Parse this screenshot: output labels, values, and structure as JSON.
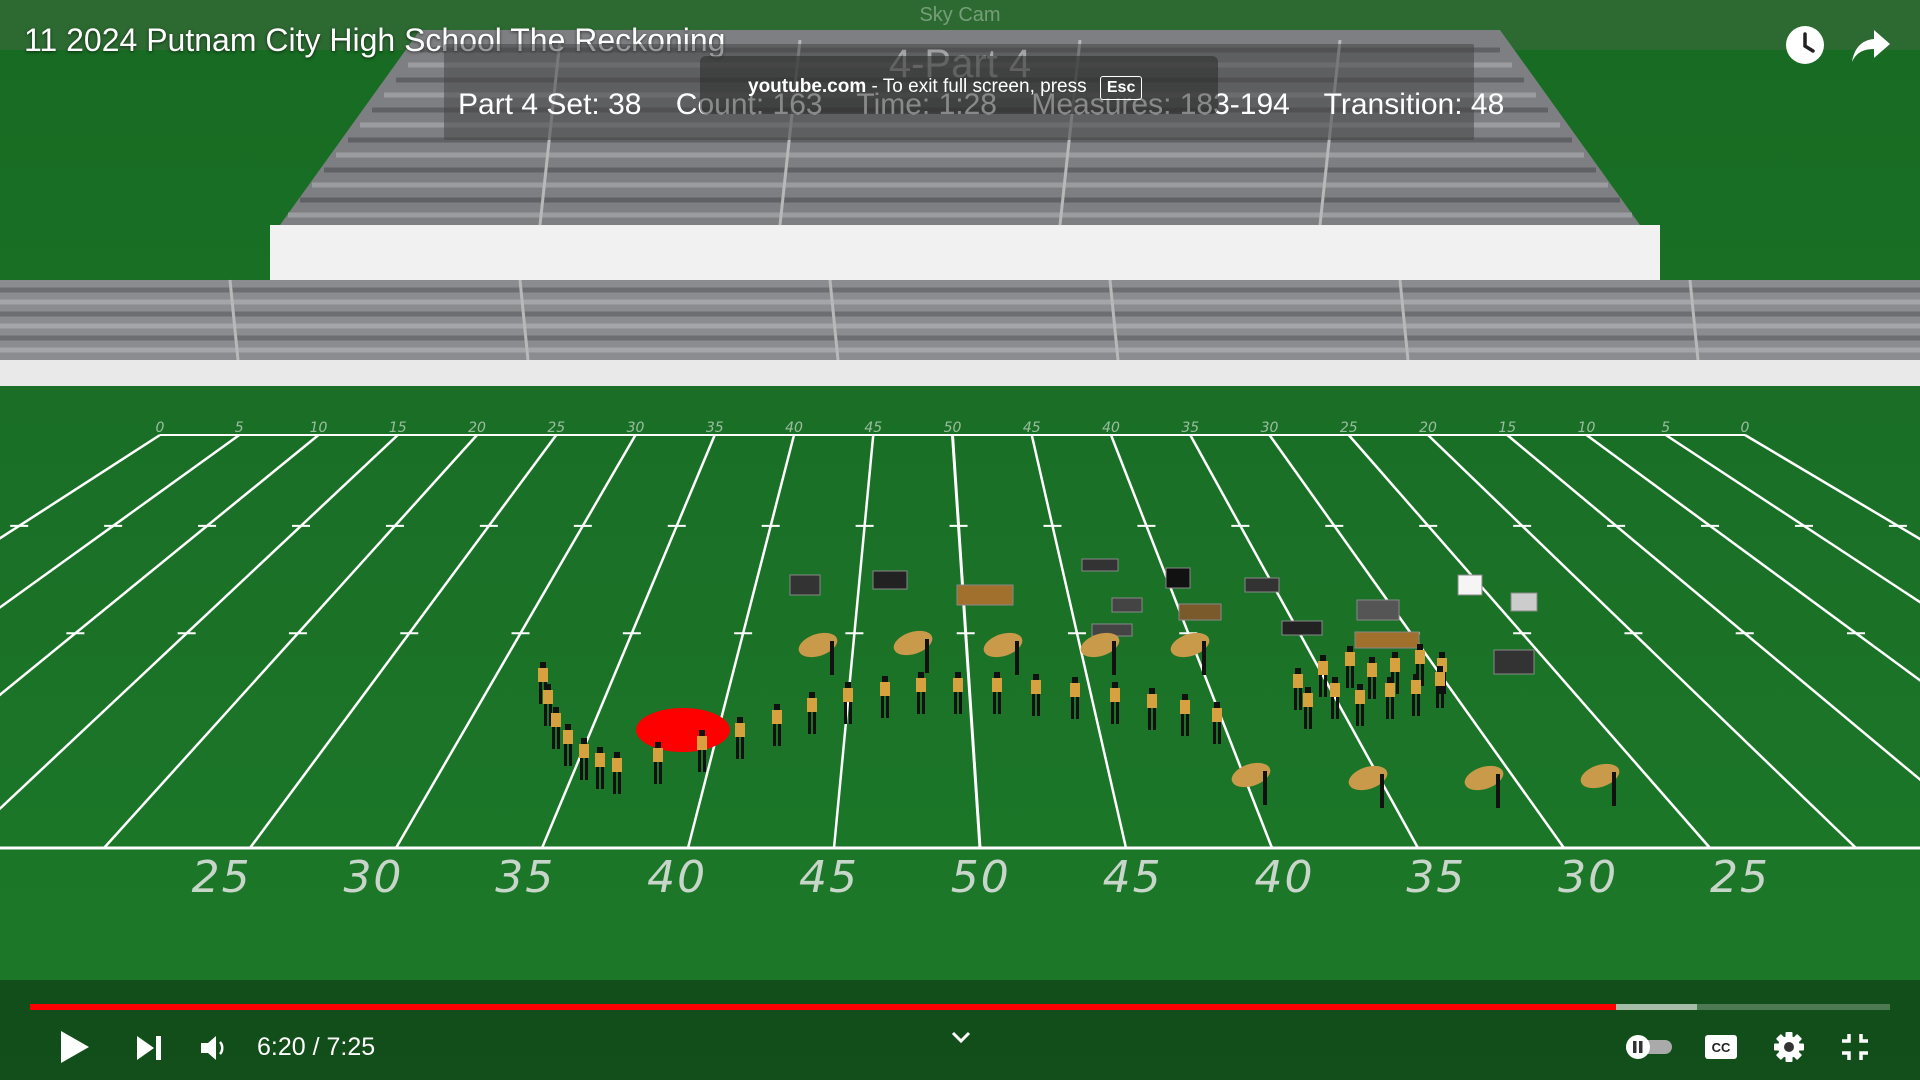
{
  "video": {
    "title": "11 2024 Putnam City High School The Reckoning"
  },
  "overlay": {
    "camera_label": "Sky Cam",
    "part_title": "4-Part 4",
    "set_label": "Part 4 Set: 38",
    "count_label": "Count: 163",
    "time_label": "Time: 1:28",
    "measures_label": "Measures: 183-194",
    "transition_label": "Transition: 48"
  },
  "fullscreen_notice": {
    "site": "youtube.com",
    "separator": "-",
    "message": "To exit full screen, press",
    "key": "Esc"
  },
  "field": {
    "yard_numbers": [
      "25",
      "30",
      "35",
      "40",
      "45",
      "50",
      "45",
      "40",
      "35",
      "30",
      "25"
    ],
    "far_numbers": [
      "0",
      "5",
      "10",
      "15",
      "20",
      "25",
      "30",
      "35",
      "40",
      "45",
      "50",
      "45",
      "40",
      "35",
      "30",
      "25",
      "20",
      "15",
      "10",
      "5",
      "0"
    ],
    "turf_color": "#1f7a2a",
    "highlight_color": "#ff0000",
    "uniform_color": "#d8a140"
  },
  "player": {
    "current_time": "6:20",
    "duration": "7:25",
    "time_display": "6:20 / 7:25",
    "played_fraction": 0.8527,
    "buffered_fraction": 0.896,
    "accent_color": "#ff0000"
  },
  "icons": {
    "watch_later": "clock-icon",
    "share": "share-arrow-icon",
    "play": "play-icon",
    "next": "next-icon",
    "volume": "volume-icon",
    "chevron": "chevron-down-icon",
    "autoplay": "autoplay-toggle-icon",
    "captions": "cc-icon",
    "settings": "gear-icon",
    "exit_fullscreen": "exit-fullscreen-icon"
  }
}
